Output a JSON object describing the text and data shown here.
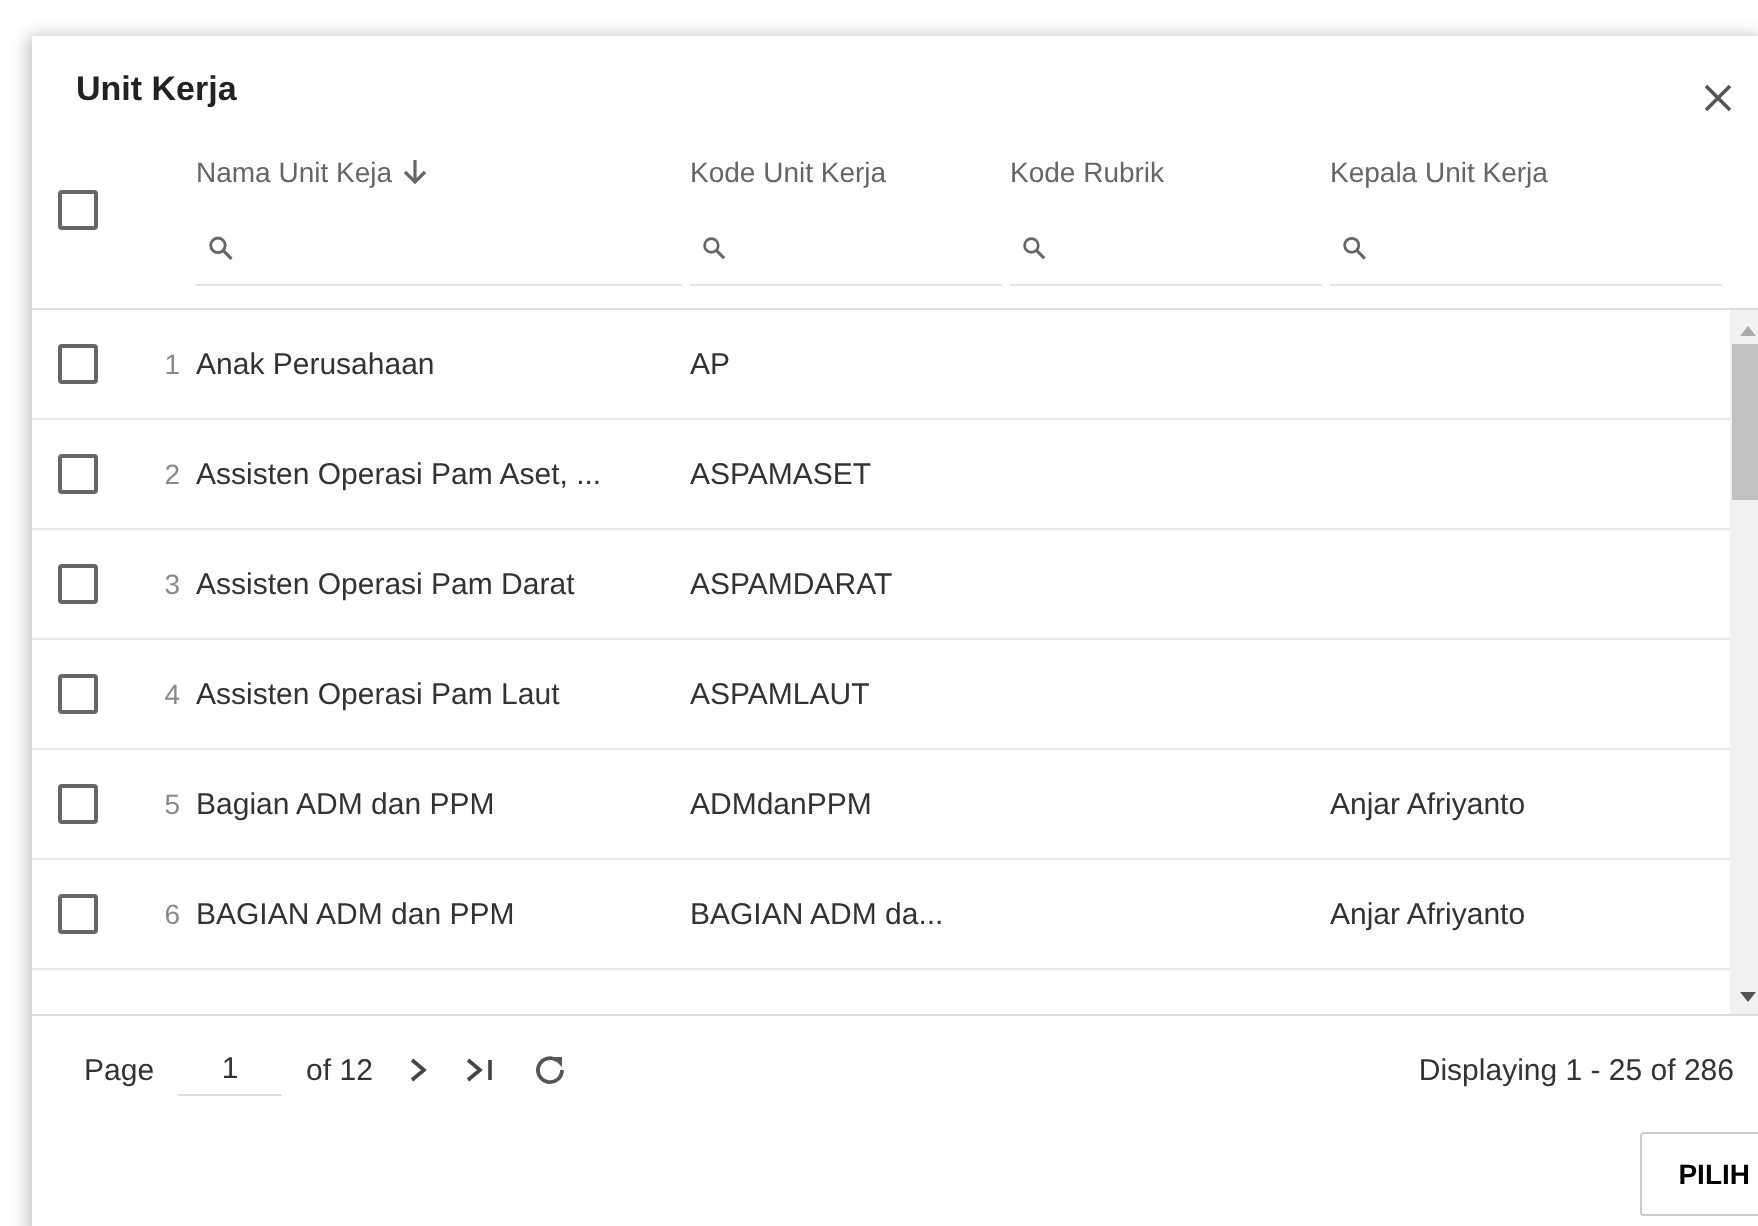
{
  "dialog": {
    "title": "Unit Kerja"
  },
  "table": {
    "select_all_checked": false,
    "columns": [
      {
        "label": "Nama Unit Keja",
        "sorted": true
      },
      {
        "label": "Kode Unit Kerja",
        "sorted": false
      },
      {
        "label": "Kode Rubrik",
        "sorted": false
      },
      {
        "label": "Kepala Unit Kerja",
        "sorted": false
      }
    ],
    "rows": [
      {
        "number": "1",
        "nama": "Anak Perusahaan",
        "kode": "AP",
        "kepala": "",
        "checked": false
      },
      {
        "number": "2",
        "nama": "Assisten Operasi Pam Aset, ...",
        "kode": "ASPAMASET",
        "kepala": "",
        "checked": false
      },
      {
        "number": "3",
        "nama": "Assisten Operasi Pam Darat",
        "kode": "ASPAMDARAT",
        "kepala": "",
        "checked": false
      },
      {
        "number": "4",
        "nama": "Assisten Operasi Pam Laut",
        "kode": "ASPAMLAUT",
        "kepala": "",
        "checked": false
      },
      {
        "number": "5",
        "nama": "Bagian ADM dan PPM",
        "kode": "ADMdanPPM",
        "kepala": "Anjar Afriyanto",
        "checked": false
      },
      {
        "number": "6",
        "nama": "BAGIAN ADM dan PPM",
        "kode": "BAGIAN ADM da...",
        "kepala": "Anjar Afriyanto",
        "checked": false
      }
    ]
  },
  "pager": {
    "page_label": "Page",
    "page": "1",
    "of": "of 12",
    "display": "Displaying 1 - 25 of 286"
  },
  "buttons": [
    "PILIH"
  ]
}
